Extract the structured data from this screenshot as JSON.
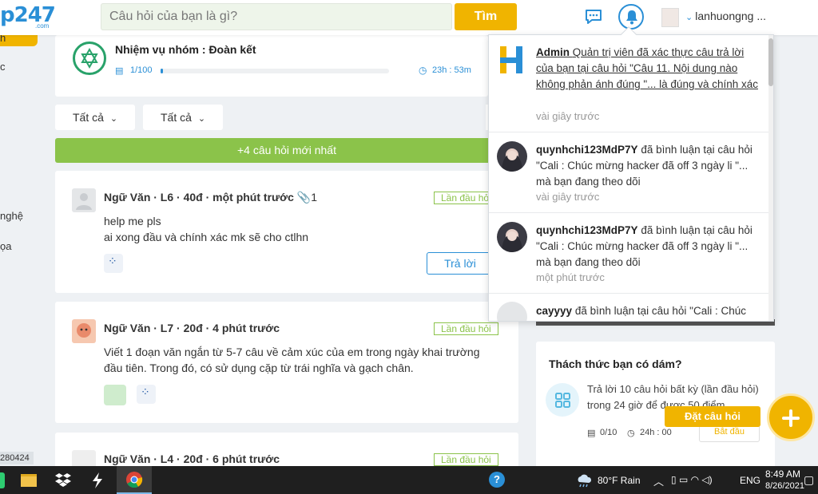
{
  "header": {
    "logo": "p247",
    "logo_sub": ".com",
    "search_placeholder": "Câu hỏi của bạn là gì?",
    "search_button": "Tìm",
    "user_name": "lanhuongng ..."
  },
  "sidebar": {
    "items": [
      "h",
      "c",
      "nghệ",
      "ọa"
    ]
  },
  "mission": {
    "title": "Nhiệm vụ nhóm : Đoàn kết",
    "count": "1/100",
    "progress": 0.01,
    "time": "23h : 53m"
  },
  "filters": [
    "Tất cả",
    "Tất cả"
  ],
  "new_questions": "+4 câu hỏi mới nhất",
  "questions": [
    {
      "meta": "Ngữ Văn · L6 · 40đ · một phút trước",
      "attach": "1",
      "tag": "Lần đầu hỏi",
      "body": [
        "help me pls",
        "ai xong đầu và chính xác mk sẽ cho ctlhn"
      ],
      "reply": "Trả lời"
    },
    {
      "meta": "Ngữ Văn · L7 · 20đ · 4 phút trước",
      "tag": "Lần đầu hỏi",
      "body": [
        "Viết 1 đoạn văn ngắn từ 5-7 câu  về cảm xúc của em trong  ngày khai trường",
        "đầu tiên. Trong đó, có sử dụng cặp từ trái nghĩa và gạch chân."
      ]
    },
    {
      "meta": "Ngữ Văn · L4 · 20đ · 6 phút trước",
      "tag": "Lần đầu hỏi"
    }
  ],
  "challenge": {
    "title": "Thách thức bạn có dám?",
    "text": "Trả lời 10 câu hỏi  bất kỳ (lần đầu hỏi) trong 24 giờ để được 50 điểm",
    "count": "0/10",
    "time": "24h : 00",
    "start": "Bắt đầu"
  },
  "ask_button": "Đặt câu hỏi",
  "left_id": "280424",
  "notifications": [
    {
      "user": "Admin",
      "text": "Quản trị viên đã xác thực câu trả lời của bạn tại câu hỏi \"Câu 11. Nội dung nào không phản ánh đúng \"... là đúng và chính xác",
      "time": "vài giây trước"
    },
    {
      "user": "quynhchi123MdP7Y",
      "text": "đã bình luận tại câu hỏi \"Cali : Chúc mừng hacker đã off 3 ngày li \"... mà bạn đang theo dõi",
      "time": "vài giây trước"
    },
    {
      "user": "quynhchi123MdP7Y",
      "text": "đã bình luận tại câu hỏi \"Cali : Chúc mừng hacker đã off 3 ngày li \"... mà bạn đang theo dõi",
      "time": "một phút trước"
    },
    {
      "user": "cayyyy",
      "text": "đã bình luận tại câu hỏi \"Cali : Chúc",
      "time": ""
    }
  ],
  "taskbar": {
    "weather": "80°F  Rain",
    "lang": "ENG",
    "time": "8:49 AM",
    "date": "8/26/2021"
  },
  "colors": {
    "accent": "#2a8fd6",
    "brand_yellow": "#f0b400",
    "green": "#8bc34a"
  }
}
